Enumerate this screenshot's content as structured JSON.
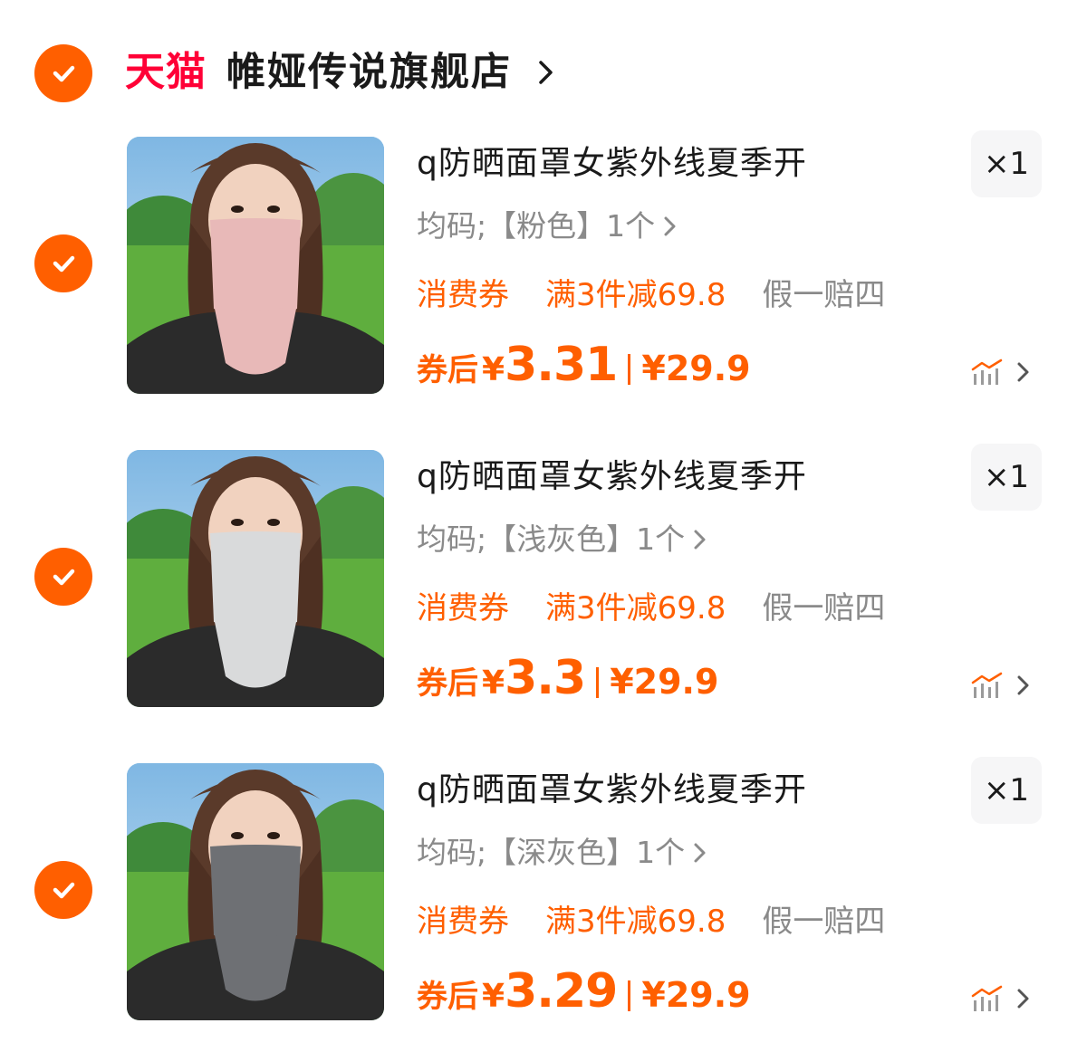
{
  "store": {
    "platform_logo": "天猫",
    "name": "帷娅传说旗舰店"
  },
  "colors": {
    "accent": "#ff5f00",
    "tmall_red": "#ff0036",
    "muted_text": "#8a8a8a"
  },
  "items": [
    {
      "title": "q防晒面罩女紫外线夏季开",
      "quantity": "×1",
      "sku": "均码;【粉色】1个",
      "tags": {
        "coupon": "消费券",
        "promo": "满3件减69.8",
        "guarantee": "假一赔四"
      },
      "price_label": "券后",
      "currency": "¥",
      "price_after": "3.31",
      "price_original": "¥29.9",
      "mask_color": "#e8b9b8"
    },
    {
      "title": "q防晒面罩女紫外线夏季开",
      "quantity": "×1",
      "sku": "均码;【浅灰色】1个",
      "tags": {
        "coupon": "消费券",
        "promo": "满3件减69.8",
        "guarantee": "假一赔四"
      },
      "price_label": "券后",
      "currency": "¥",
      "price_after": "3.3",
      "price_original": "¥29.9",
      "mask_color": "#d9dadb"
    },
    {
      "title": "q防晒面罩女紫外线夏季开",
      "quantity": "×1",
      "sku": "均码;【深灰色】1个",
      "tags": {
        "coupon": "消费券",
        "promo": "满3件减69.8",
        "guarantee": "假一赔四"
      },
      "price_label": "券后",
      "currency": "¥",
      "price_after": "3.29",
      "price_original": "¥29.9",
      "mask_color": "#6e7074"
    }
  ]
}
